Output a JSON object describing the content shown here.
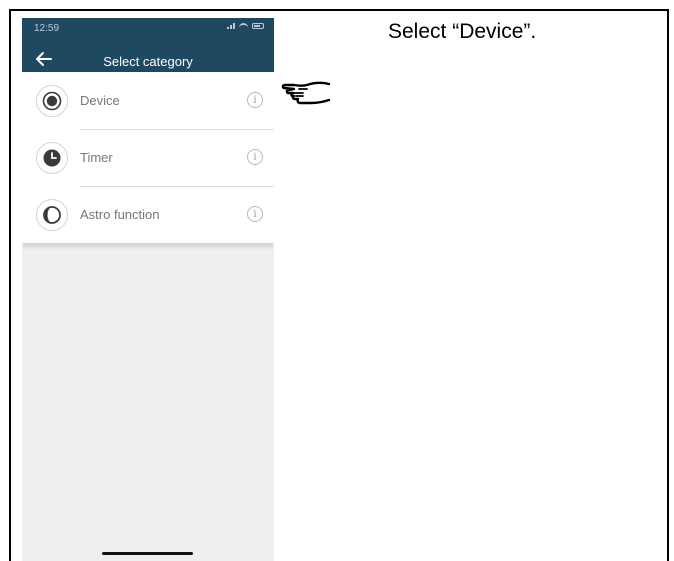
{
  "instruction": "Select “Device”.",
  "phone": {
    "status_time": "12:59",
    "title": "Select category",
    "items": [
      {
        "label": "Device",
        "icon": "device-icon",
        "info": "i"
      },
      {
        "label": "Timer",
        "icon": "clock-icon",
        "info": "i"
      },
      {
        "label": "Astro function",
        "icon": "moon-icon",
        "info": "i"
      }
    ]
  },
  "colors": {
    "appbar": "#1f4861",
    "list_background": "#ffffff",
    "content_background": "#efefef",
    "icon": "#3a3a3a"
  },
  "pointer_icon": "pointing-hand-icon"
}
